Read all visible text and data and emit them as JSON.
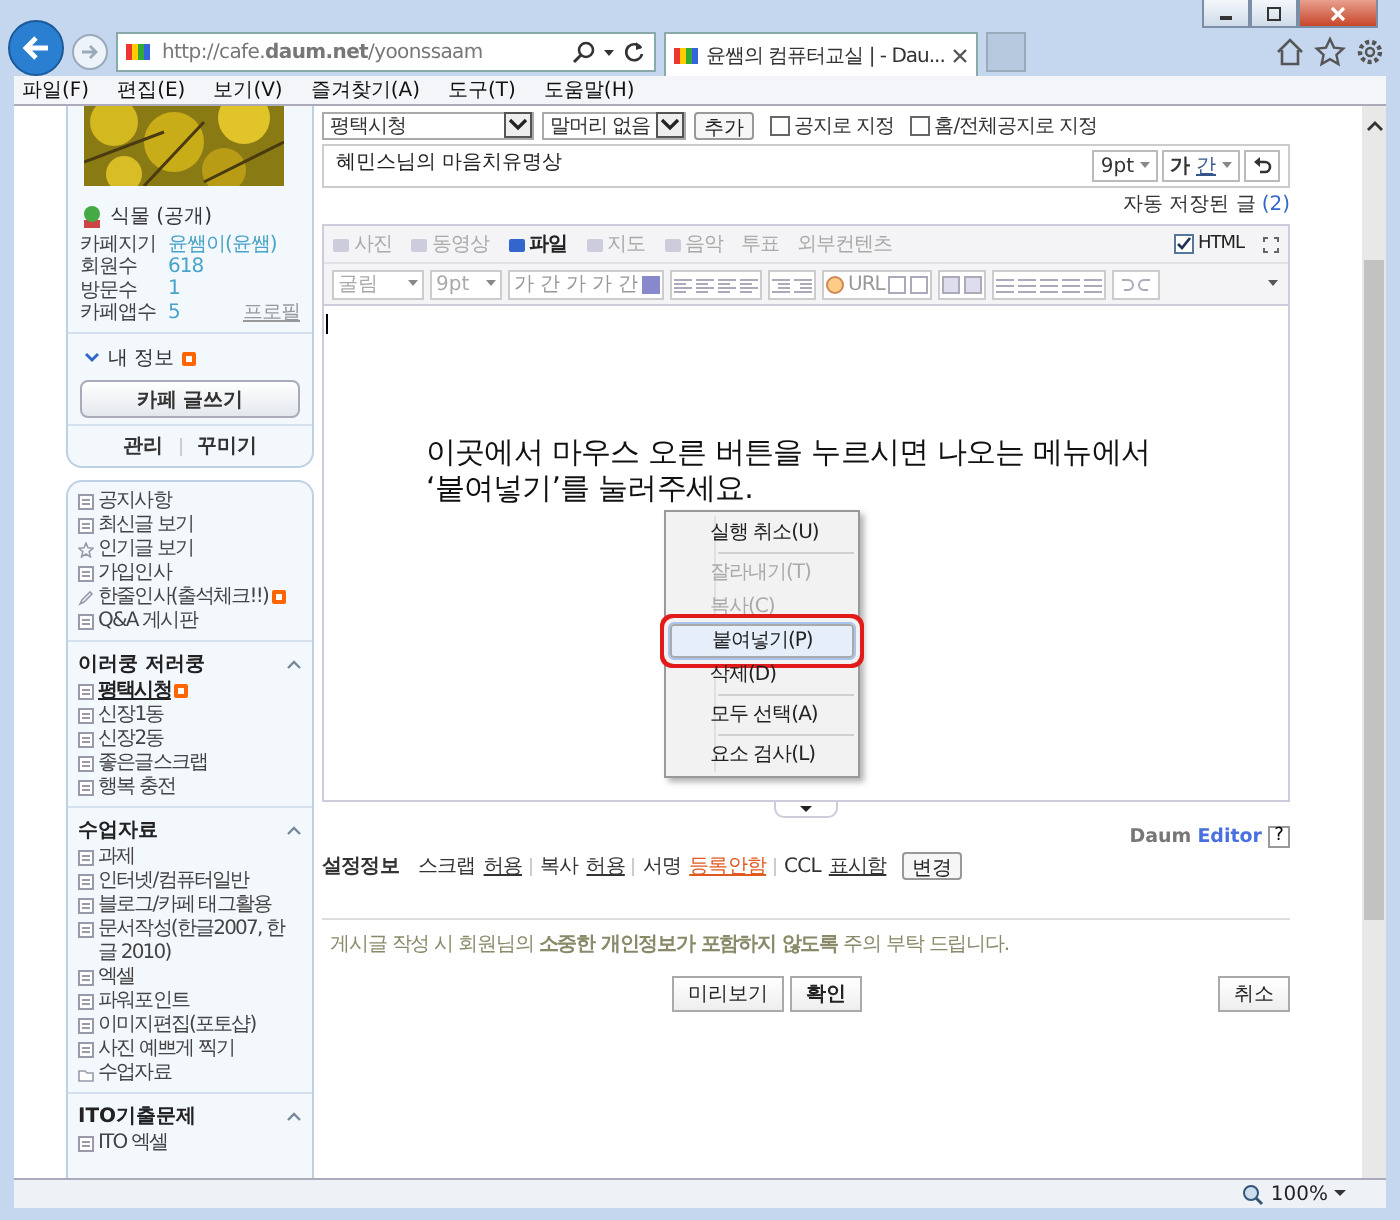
{
  "browser": {
    "address": "http://cafe.**daum.net**/yoonssaam",
    "tab_title": "윤쌤의 컴퓨터교실 | - Dau...",
    "menu": [
      "파일(F)",
      "편집(E)",
      "보기(V)",
      "즐겨찾기(A)",
      "도구(T)",
      "도움말(H)"
    ]
  },
  "sidebar": {
    "status": "식물 (공개)",
    "stats": [
      {
        "label": "카페지기",
        "value": "윤쌤이(윤쌤)"
      },
      {
        "label": "회원수",
        "value": "618"
      },
      {
        "label": "방문수",
        "value": "1"
      },
      {
        "label": "카페앱수",
        "value": "5"
      }
    ],
    "profile_link": "프로필",
    "my_info": "내 정보",
    "my_info_new": true,
    "write_button": "카페 글쓰기",
    "admin_links": [
      "관리",
      "꾸미기"
    ],
    "menu_groups": [
      {
        "items": [
          {
            "label": "공지사항",
            "kind": "board",
            "new": false,
            "selected": false
          },
          {
            "label": "최신글 보기",
            "kind": "board",
            "new": false,
            "selected": false
          },
          {
            "label": "인기글 보기",
            "kind": "star",
            "new": false,
            "selected": false
          },
          {
            "label": "가입인사",
            "kind": "board",
            "new": false,
            "selected": false
          },
          {
            "label": "한줄인사(출석체크!!)",
            "kind": "pen",
            "new": true,
            "selected": false
          },
          {
            "label": "Q&A 게시판",
            "kind": "board",
            "new": false,
            "selected": false
          }
        ]
      },
      {
        "title": "이러쿵 저러쿵",
        "items": [
          {
            "label": "평택시청",
            "kind": "board",
            "new": true,
            "selected": true
          },
          {
            "label": "신장1동",
            "kind": "board",
            "new": false,
            "selected": false
          },
          {
            "label": "신장2동",
            "kind": "board",
            "new": false,
            "selected": false
          },
          {
            "label": "좋은글스크랩",
            "kind": "board",
            "new": false,
            "selected": false
          },
          {
            "label": "행복 충전",
            "kind": "board",
            "new": false,
            "selected": false
          }
        ]
      },
      {
        "title": "수업자료",
        "items": [
          {
            "label": "과제",
            "kind": "board",
            "new": false,
            "selected": false
          },
          {
            "label": "인터넷/컴퓨터일반",
            "kind": "board",
            "new": false,
            "selected": false
          },
          {
            "label": "블로그/카페 태그활용",
            "kind": "board",
            "new": false,
            "selected": false
          },
          {
            "label": "문서작성(한글2007, 한글 2010)",
            "kind": "board",
            "new": false,
            "selected": false
          },
          {
            "label": "엑셀",
            "kind": "board",
            "new": false,
            "selected": false
          },
          {
            "label": "파워포인트",
            "kind": "board",
            "new": false,
            "selected": false
          },
          {
            "label": "이미지편집(포토샵)",
            "kind": "board",
            "new": false,
            "selected": false
          },
          {
            "label": "사진 예쁘게 찍기",
            "kind": "board",
            "new": false,
            "selected": false
          },
          {
            "label": "수업자료",
            "kind": "folder",
            "new": false,
            "selected": false
          }
        ]
      },
      {
        "title": "ITO기출문제",
        "items": [
          {
            "label": "ITO 엑셀",
            "kind": "board",
            "new": false,
            "selected": false
          }
        ]
      }
    ]
  },
  "editor": {
    "board": "평택시청",
    "prefix": "말머리 없음",
    "add_button": "추가",
    "notice_options": [
      {
        "label": "공지로 지정",
        "checked": false
      },
      {
        "label": "홈/전체공지로 지정",
        "checked": false
      }
    ],
    "title": "혜민스님의 마음치유명상",
    "title_font_size": "9pt",
    "title_style_buttons": [
      "가",
      "간"
    ],
    "autosave_label": "자동 저장된 글",
    "autosave_count": "(2)",
    "attach_tools": [
      {
        "label": "사진",
        "enabled": false
      },
      {
        "label": "동영상",
        "enabled": false
      },
      {
        "label": "파일",
        "enabled": true
      },
      {
        "label": "지도",
        "enabled": false
      },
      {
        "label": "음악",
        "enabled": false
      },
      {
        "label": "투표",
        "enabled": false
      },
      {
        "label": "외부컨텐츠",
        "enabled": false
      }
    ],
    "html_mode": {
      "label": "HTML",
      "checked": true
    },
    "format_toolbar": {
      "font": "굴림",
      "size": "9pt",
      "text_buttons": [
        "가",
        "간",
        "가",
        "가",
        "간"
      ],
      "url": "URL"
    },
    "body_lines": [
      "이곳에서 마우스 오른 버튼을 누르시면 나오는 메뉴에서",
      "‘붙여넣기’를 눌러주세요."
    ],
    "context_menu": [
      [
        {
          "label": "실행 취소(U)",
          "disabled": false,
          "selected": false
        }
      ],
      [
        {
          "label": "잘라내기(T)",
          "disabled": true,
          "selected": false
        },
        {
          "label": "복사(C)",
          "disabled": true,
          "selected": false
        },
        {
          "label": "붙여넣기(P)",
          "disabled": false,
          "selected": true
        },
        {
          "label": "삭제(D)",
          "disabled": false,
          "selected": false
        }
      ],
      [
        {
          "label": "모두 선택(A)",
          "disabled": false,
          "selected": false
        }
      ],
      [
        {
          "label": "요소 검사(L)",
          "disabled": false,
          "selected": false
        }
      ]
    ],
    "brand": "Daum",
    "brand_product": "Editor",
    "help": "?",
    "settings_label": "설정정보",
    "settings": [
      {
        "label": "스크랩",
        "value": "허용",
        "warn": false
      },
      {
        "label": "복사",
        "value": "허용",
        "warn": false
      },
      {
        "label": "서명",
        "value": "등록안함",
        "warn": true
      },
      {
        "label": "CCL",
        "value": "표시함",
        "warn": false
      }
    ],
    "change_button": "변경",
    "notice": "게시글 작성 시 회원님의 **소중한 개인정보가 포함하지 않도록** 주의 부탁 드립니다.",
    "buttons": [
      "미리보기",
      "확인"
    ],
    "cancel_button": "취소"
  },
  "status_bar": {
    "zoom": "100%"
  }
}
